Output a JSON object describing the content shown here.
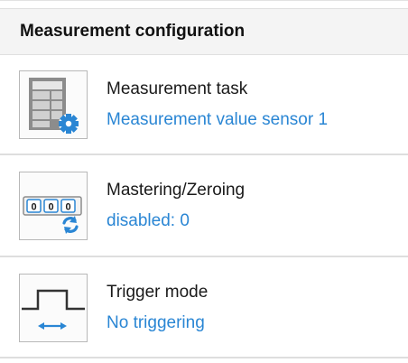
{
  "panel": {
    "title": "Measurement configuration"
  },
  "items": [
    {
      "label": "Measurement task",
      "value": "Measurement value sensor 1",
      "icon": "measurement-task-icon"
    },
    {
      "label": "Mastering/Zeroing",
      "value": "disabled: 0",
      "icon": "mastering-zeroing-icon",
      "icon_digits": [
        "0",
        "0",
        "0"
      ]
    },
    {
      "label": "Trigger mode",
      "value": "No triggering",
      "icon": "trigger-mode-icon"
    }
  ],
  "colors": {
    "link_blue": "#2a86d4",
    "header_bg": "#f4f4f4",
    "divider": "#dedede",
    "icon_border": "#b8b8b8"
  }
}
